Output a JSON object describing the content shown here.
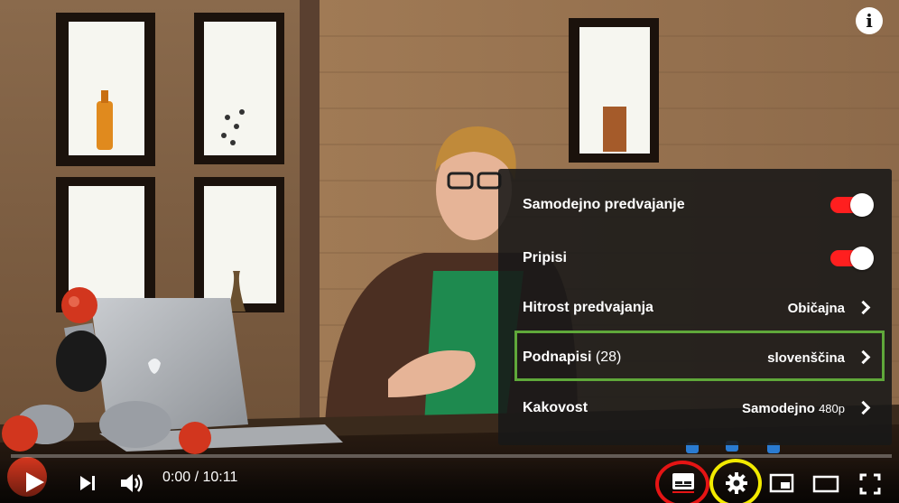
{
  "player": {
    "info_label": "i",
    "time": {
      "current": "0:00",
      "separator": " / ",
      "duration": "10:11"
    }
  },
  "settings_menu": {
    "items": [
      {
        "label": "Samodejno predvajanje",
        "type": "toggle",
        "on": true
      },
      {
        "label": "Pripisi",
        "type": "toggle",
        "on": true
      },
      {
        "label": "Hitrost predvajanja",
        "type": "submenu",
        "value": "Običajna"
      },
      {
        "label": "Podnapisi",
        "count": "(28)",
        "type": "submenu",
        "value": "slovenščina",
        "highlighted": true
      },
      {
        "label": "Kakovost",
        "type": "submenu",
        "value": "Samodejno",
        "value_suffix": "480p"
      }
    ]
  },
  "colors": {
    "toggle_on": "#ff1f1f",
    "highlight_green": "#5fa83a",
    "ring_red": "#e51414",
    "ring_yellow": "#f3ea00"
  },
  "icons": [
    "play-icon",
    "next-icon",
    "volume-icon",
    "subtitles-icon",
    "settings-gear-icon",
    "miniplayer-icon",
    "theater-mode-icon",
    "fullscreen-icon",
    "info-icon"
  ]
}
